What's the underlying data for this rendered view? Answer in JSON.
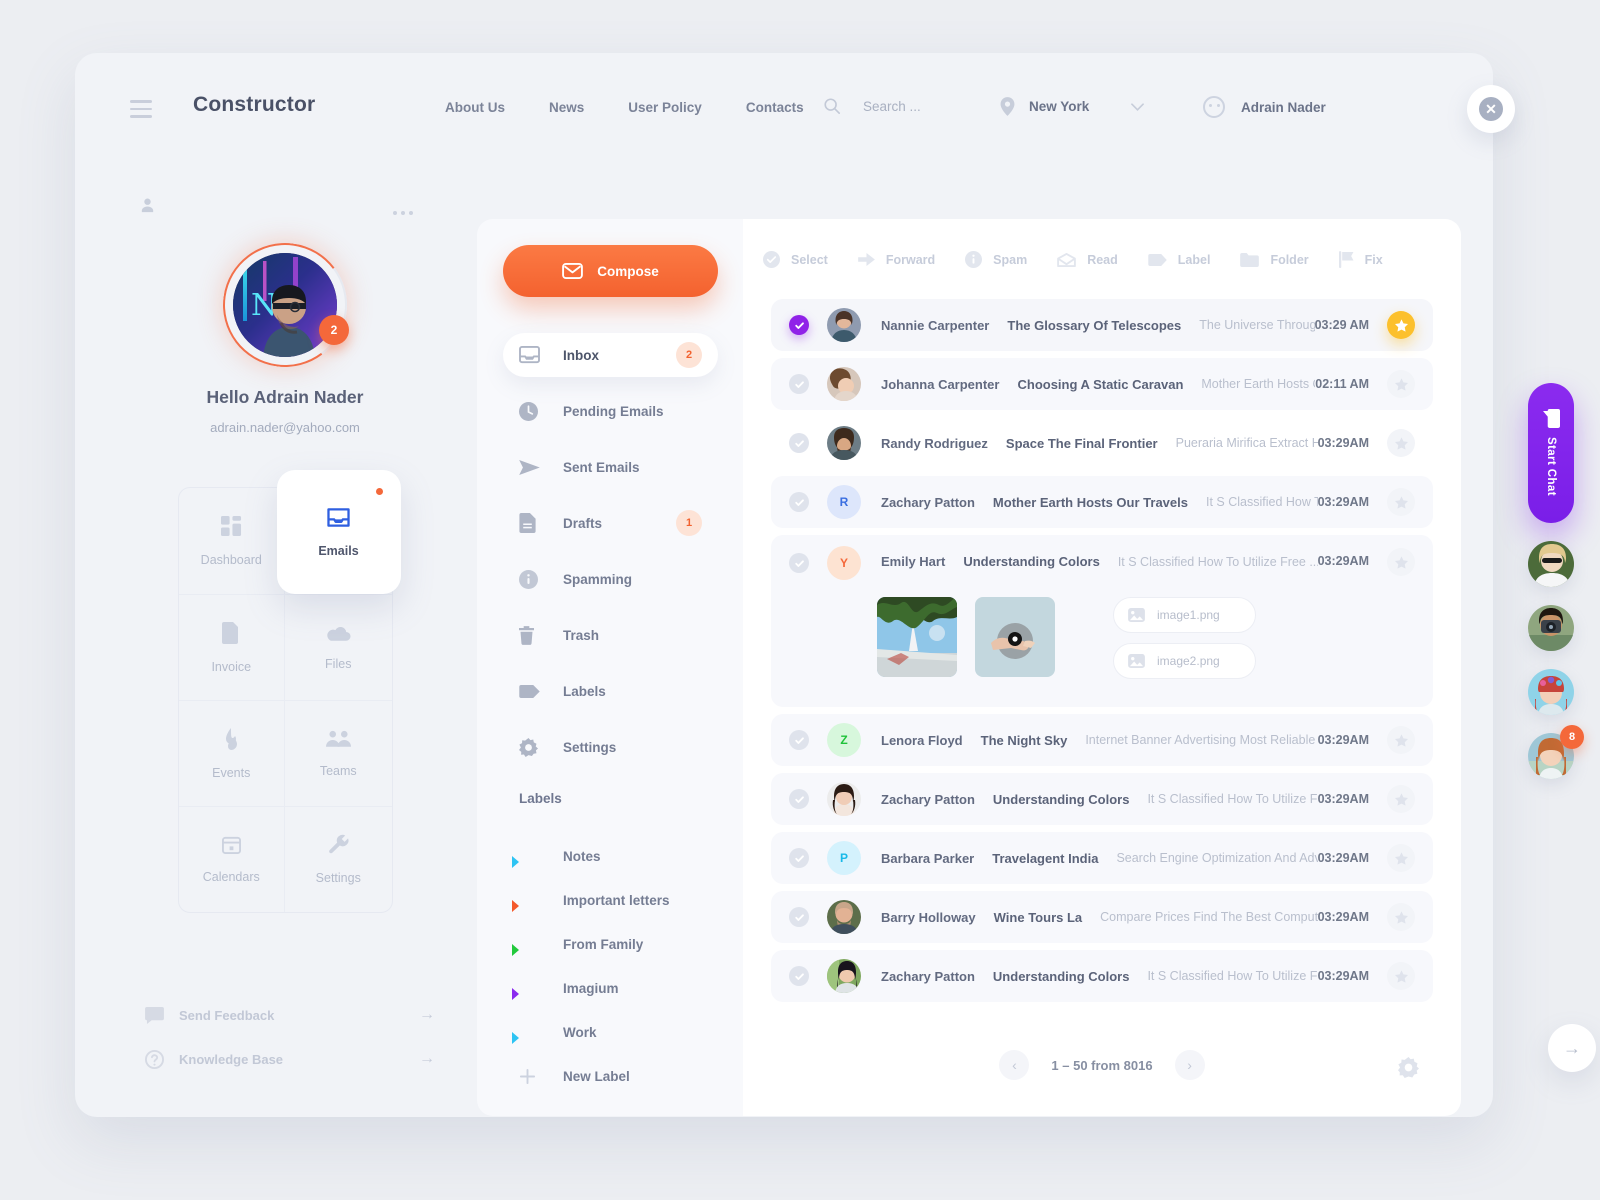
{
  "header": {
    "brand": "Constructor",
    "nav": [
      "About Us",
      "News",
      "User Policy",
      "Contacts"
    ],
    "search_placeholder": "Search ...",
    "search_value": "",
    "location": "New York",
    "account": "Adrain Nader"
  },
  "profile": {
    "greeting": "Hello Adrain Nader",
    "email": "adrain.nader@yahoo.com",
    "badge": "2"
  },
  "apps": [
    {
      "label": "Dashboard",
      "icon": "dashboard-icon"
    },
    {
      "label": "Emails",
      "icon": "inbox-icon"
    },
    {
      "label": "Invoice",
      "icon": "document-icon"
    },
    {
      "label": "Files",
      "icon": "cloud-icon"
    },
    {
      "label": "Events",
      "icon": "fire-icon"
    },
    {
      "label": "Teams",
      "icon": "people-icon"
    },
    {
      "label": "Calendars",
      "icon": "calendar-icon"
    },
    {
      "label": "Settings",
      "icon": "wrench-icon"
    }
  ],
  "bottom_links": [
    {
      "label": "Send Feedback",
      "icon": "chat-icon"
    },
    {
      "label": "Knowledge Base",
      "icon": "help-icon"
    }
  ],
  "mailnav": {
    "compose": "Compose",
    "items": [
      {
        "label": "Inbox",
        "icon": "inbox-icon",
        "badge": "2",
        "active": true
      },
      {
        "label": "Pending Emails",
        "icon": "clock-icon",
        "badge": ""
      },
      {
        "label": "Sent Emails",
        "icon": "send-icon",
        "badge": ""
      },
      {
        "label": "Drafts",
        "icon": "draft-icon",
        "badge": "1"
      },
      {
        "label": "Spamming",
        "icon": "info-icon",
        "badge": ""
      },
      {
        "label": "Trash",
        "icon": "trash-icon",
        "badge": ""
      },
      {
        "label": "Labels",
        "icon": "tag-icon",
        "badge": ""
      },
      {
        "label": "Settings",
        "icon": "gear-icon",
        "badge": ""
      }
    ],
    "labels_heading": "Labels",
    "labels": [
      {
        "label": "Notes",
        "color": "#2ec4f3"
      },
      {
        "label": "Important letters",
        "color": "#f4592b"
      },
      {
        "label": "From Family",
        "color": "#22c93c"
      },
      {
        "label": "Imagium",
        "color": "#8b2bef"
      },
      {
        "label": "Work",
        "color": "#2ec4f3"
      }
    ],
    "new_label": "New Label"
  },
  "toolbar": [
    {
      "label": "Select",
      "icon": "check-circle-icon"
    },
    {
      "label": "Forward",
      "icon": "forward-arrow-icon"
    },
    {
      "label": "Spam",
      "icon": "info-icon"
    },
    {
      "label": "Read",
      "icon": "open-envelope-icon"
    },
    {
      "label": "Label",
      "icon": "tag-icon"
    },
    {
      "label": "Folder",
      "icon": "folder-icon"
    },
    {
      "label": "Fix",
      "icon": "flag-icon"
    }
  ],
  "emails": [
    {
      "sender": "Nannie Carpenter",
      "subject": "The Glossary Of Telescopes",
      "snippet": "The Universe Through A Child S Eyes",
      "time": "03:29 AM",
      "selected": true,
      "starred": true,
      "avatar": "photo-woman-1",
      "initial": "",
      "avatar_color": ""
    },
    {
      "sender": "Johanna Carpenter",
      "subject": "Choosing A Static Caravan",
      "snippet": "Mother Earth Hosts Our Travels",
      "time": "02:11 AM",
      "selected": false,
      "starred": false,
      "avatar": "photo-woman-2",
      "initial": "",
      "avatar_color": ""
    },
    {
      "sender": "Randy Rodriguez",
      "subject": "Space The Final Frontier",
      "snippet": "Pueraria Mirifica Extract Helps Wrinkled",
      "time": "03:29AM",
      "selected": false,
      "starred": false,
      "avatar": "photo-man-1",
      "initial": "",
      "avatar_color": ""
    },
    {
      "sender": "Zachary Patton",
      "subject": "Mother Earth Hosts Our Travels",
      "snippet": "It S Classified How To Utilize Free ...",
      "time": "03:29AM",
      "selected": false,
      "starred": false,
      "avatar": "",
      "initial": "R",
      "avatar_color": "#dde6fb",
      "initial_color": "#3b6fe0"
    },
    {
      "sender": "Emily Hart",
      "subject": "Understanding Colors",
      "snippet": "It S Classified How To Utilize Free ...",
      "time": "03:29AM",
      "selected": false,
      "starred": false,
      "avatar": "",
      "initial": "Y",
      "avatar_color": "#fde3d2",
      "initial_color": "#f4683a",
      "expanded": true,
      "attachments": [
        {
          "name": "image1.png",
          "thumb": "sky-trees-photo"
        },
        {
          "name": "image2.png",
          "thumb": "hand-disc-photo"
        }
      ]
    },
    {
      "sender": "Lenora Floyd",
      "subject": "The Night Sky",
      "snippet": "Internet Banner Advertising Most Reliable ...",
      "time": "03:29AM",
      "selected": false,
      "starred": false,
      "avatar": "",
      "initial": "Z",
      "avatar_color": "#d7f7dc",
      "initial_color": "#1fc23a"
    },
    {
      "sender": "Zachary Patton",
      "subject": "Understanding Colors",
      "snippet": "It S Classified How To Utilize Free ...",
      "time": "03:29AM",
      "selected": false,
      "starred": false,
      "avatar": "photo-woman-3",
      "initial": "",
      "avatar_color": ""
    },
    {
      "sender": "Barbara Parker",
      "subject": "Travelagent India",
      "snippet": "Search Engine Optimization And Advertising",
      "time": "03:29AM",
      "selected": false,
      "starred": false,
      "avatar": "",
      "initial": "P",
      "avatar_color": "#d4f2fd",
      "initial_color": "#18b9e8"
    },
    {
      "sender": "Barry Holloway",
      "subject": "Wine Tours La",
      "snippet": "Compare Prices Find The Best Computer Accessory",
      "time": "03:29AM",
      "selected": false,
      "starred": false,
      "avatar": "photo-man-2",
      "initial": "",
      "avatar_color": ""
    },
    {
      "sender": "Zachary Patton",
      "subject": "Understanding Colors",
      "snippet": "It S Classified How To Utilize Free ...",
      "time": "03:29AM",
      "selected": false,
      "starred": false,
      "avatar": "photo-woman-4",
      "initial": "",
      "avatar_color": ""
    }
  ],
  "pager": {
    "prev": "‹",
    "next": "›",
    "range": "1 – 50 from 8016"
  },
  "rail": {
    "start_chat": "Start Chat",
    "contacts": [
      {
        "avatar": "photo-blonde-sunglasses",
        "badge": ""
      },
      {
        "avatar": "photo-photographer",
        "badge": ""
      },
      {
        "avatar": "photo-flower-helmet",
        "badge": ""
      },
      {
        "avatar": "photo-redhead",
        "badge": "8"
      }
    ]
  },
  "next_button": "→",
  "colors": {
    "accent": "#f4683a",
    "purple": "#8b2bef",
    "star": "#fcc02c"
  }
}
